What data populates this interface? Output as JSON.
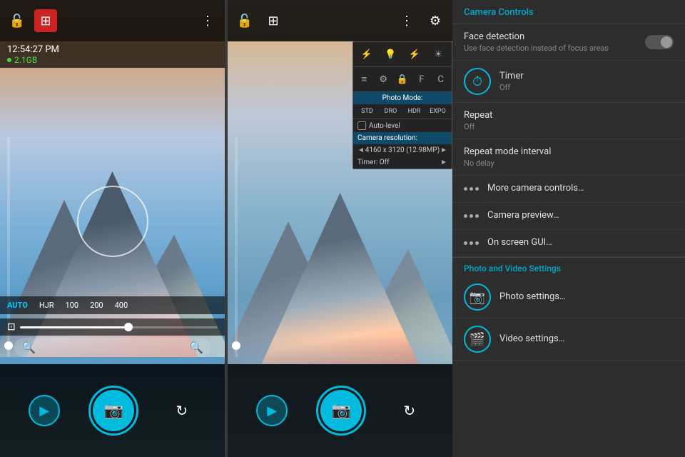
{
  "leftPanel": {
    "time": "12:54:27 PM",
    "storage": "2.1GB",
    "isoOptions": [
      "AUTO",
      "HJR",
      "100",
      "200",
      "400"
    ],
    "isoSelected": "AUTO"
  },
  "middlePanel": {
    "dropdown": {
      "modes": [
        "STD",
        "DRO",
        "HDR",
        "EXPO"
      ],
      "photoModeLabel": "Photo Mode:",
      "autoLevel": "Auto-level",
      "cameraResolution": "Camera resolution:",
      "resolutionValue": "4160 x 3120 (12.98MP)",
      "timerLabel": "Timer: Off"
    }
  },
  "rightPanel": {
    "header": "Camera Controls",
    "items": [
      {
        "id": "face-detection",
        "title": "Face detection",
        "subtitle": "Use face detection instead of focus areas",
        "type": "toggle",
        "value": false,
        "icon": null
      },
      {
        "id": "timer",
        "title": "Timer",
        "subtitle": "Off",
        "type": "icon",
        "icon": "⏱"
      },
      {
        "id": "repeat",
        "title": "Repeat",
        "subtitle": "Off",
        "type": "plain"
      },
      {
        "id": "repeat-mode-interval",
        "title": "Repeat mode interval",
        "subtitle": "No delay",
        "type": "plain"
      },
      {
        "id": "more-camera-controls",
        "title": "More camera controls…",
        "subtitle": null,
        "type": "dots"
      },
      {
        "id": "camera-preview",
        "title": "Camera preview…",
        "subtitle": null,
        "type": "dots"
      },
      {
        "id": "on-screen-gui",
        "title": "On screen GUI…",
        "subtitle": null,
        "type": "dots"
      }
    ],
    "photoVideoSection": "Photo and Video Settings",
    "photoVideoItems": [
      {
        "id": "photo-settings",
        "title": "Photo settings…",
        "icon": "📷",
        "iconColor": "#00bbdd"
      },
      {
        "id": "video-settings",
        "title": "Video settings…",
        "icon": "🎬",
        "iconColor": "#00bbdd"
      }
    ]
  }
}
